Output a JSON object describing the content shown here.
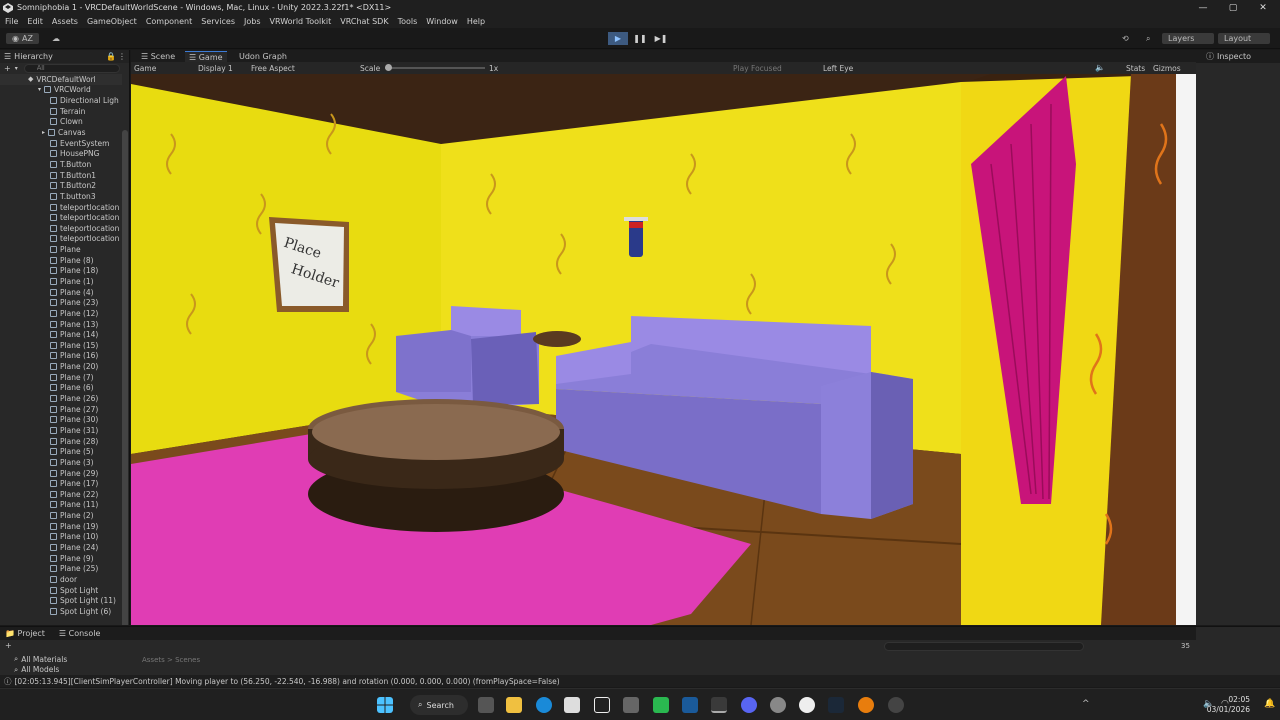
{
  "window": {
    "title": "Somniphobia 1 - VRCDefaultWorldScene - Windows, Mac, Linux - Unity 2022.3.22f1* <DX11>",
    "minimize": "—",
    "maximize": "▢",
    "close": "✕"
  },
  "menu": [
    "File",
    "Edit",
    "Assets",
    "GameObject",
    "Component",
    "Services",
    "Jobs",
    "VRWorld Toolkit",
    "VRChat SDK",
    "Tools",
    "Window",
    "Help"
  ],
  "toolbar": {
    "account": "AZ",
    "play": "▶",
    "pause": "❚❚",
    "step": "▶❚",
    "layers": "Layers",
    "layout": "Layout"
  },
  "hierarchy": {
    "tab": "Hierarchy",
    "search_placeholder": "All",
    "root": "VRCDefaultWorl",
    "items": [
      "VRCWorld",
      "Directional Ligh",
      "Terrain",
      "Clown",
      "Canvas",
      "EventSystem",
      "HousePNG",
      "T.Button",
      "T.Button1",
      "T.Button2",
      "T.button3",
      "teleportlocation",
      "teleportlocation",
      "teleportlocation",
      "teleportlocation",
      "Plane",
      "Plane (8)",
      "Plane (18)",
      "Plane (1)",
      "Plane (4)",
      "Plane (23)",
      "Plane (12)",
      "Plane (13)",
      "Plane (14)",
      "Plane (15)",
      "Plane (16)",
      "Plane (20)",
      "Plane (7)",
      "Plane (6)",
      "Plane (26)",
      "Plane (27)",
      "Plane (30)",
      "Plane (31)",
      "Plane (28)",
      "Plane (5)",
      "Plane (3)",
      "Plane (29)",
      "Plane (17)",
      "Plane (22)",
      "Plane (11)",
      "Plane (2)",
      "Plane (19)",
      "Plane (10)",
      "Plane (24)",
      "Plane (9)",
      "Plane (25)",
      "door",
      "Spot Light",
      "Spot Light (11)",
      "Spot Light (6)"
    ]
  },
  "viewport": {
    "tabs": [
      "Scene",
      "Game",
      "Udon Graph"
    ],
    "game_label": "Game",
    "display": "Display 1",
    "aspect": "Free Aspect",
    "scale_label": "Scale",
    "scale_value": "1x",
    "play_focused": "Play Focused",
    "eye": "Left Eye",
    "stats": "Stats",
    "gizmos": "Gizmos",
    "frame_text_1": "Place",
    "frame_text_2": "Holder"
  },
  "inspector": {
    "tab": "Inspecto"
  },
  "bottom": {
    "tabs": [
      "Project",
      "Console"
    ],
    "items": [
      "All Materials",
      "All Models"
    ],
    "crumbs": "Assets > Scenes",
    "count": "35"
  },
  "status": {
    "message": "[02:05:13.945][ClientSimPlayerController] Moving player to (56.250, -22.540, -16.988) and rotation (0.000, 0.000, 0.000) (fromPlaySpace=False)"
  },
  "taskbar": {
    "search": "Search",
    "time": "02:05",
    "date": "03/01/2026"
  },
  "colors": {
    "wall": "#f2e21a",
    "sofa": "#9a8ae0",
    "rug": "#e23fb6",
    "curtain": "#c8147a"
  }
}
